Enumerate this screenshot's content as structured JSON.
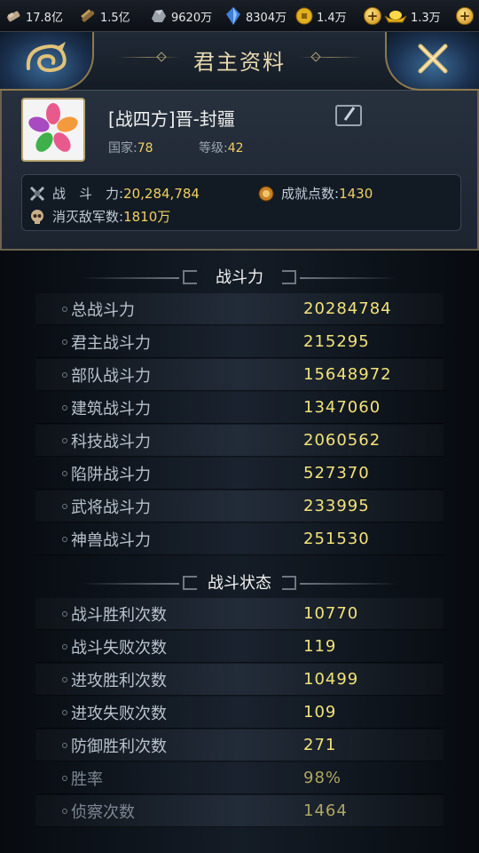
{
  "resources": [
    {
      "icon": "ingot-icon",
      "value": "17.8亿"
    },
    {
      "icon": "wood-icon",
      "value": "1.5亿"
    },
    {
      "icon": "stone-icon",
      "value": "9620万"
    },
    {
      "icon": "crystal-icon",
      "value": "8304万"
    },
    {
      "icon": "coin-icon",
      "value": "1.4万"
    },
    {
      "icon": "gold-ingot-icon",
      "value": "1.3万"
    }
  ],
  "header": {
    "title": "君主资料"
  },
  "profile": {
    "name": "[战四方]晋-封疆",
    "country_label": "国家:",
    "country_value": "78",
    "level_label": "等级:",
    "level_value": "42",
    "power_label": "战　斗　力:",
    "power_value": "20,284,784",
    "achievement_label": "成就点数:",
    "achievement_value": "1430",
    "kills_label": "消灭敌军数:",
    "kills_value": "1810万"
  },
  "sections": [
    {
      "title": "战斗力",
      "rows": [
        {
          "label": "总战斗力",
          "value": "20284784"
        },
        {
          "label": "君主战斗力",
          "value": "215295"
        },
        {
          "label": "部队战斗力",
          "value": "15648972"
        },
        {
          "label": "建筑战斗力",
          "value": "1347060"
        },
        {
          "label": "科技战斗力",
          "value": "2060562"
        },
        {
          "label": "陷阱战斗力",
          "value": "527370"
        },
        {
          "label": "武将战斗力",
          "value": "233995"
        },
        {
          "label": "神兽战斗力",
          "value": "251530"
        }
      ]
    },
    {
      "title": "战斗状态",
      "rows": [
        {
          "label": "战斗胜利次数",
          "value": "10770"
        },
        {
          "label": "战斗失败次数",
          "value": "119"
        },
        {
          "label": "进攻胜利次数",
          "value": "10499"
        },
        {
          "label": "进攻失败次数",
          "value": "109"
        },
        {
          "label": "防御胜利次数",
          "value": "271"
        },
        {
          "label": "胜率",
          "value": "98%"
        },
        {
          "label": "侦察次数",
          "value": "1464"
        }
      ]
    }
  ],
  "colors": {
    "accent_value": "#f4e37a",
    "frame_gold": "#b9a674",
    "header_text": "#e8d9b0"
  }
}
